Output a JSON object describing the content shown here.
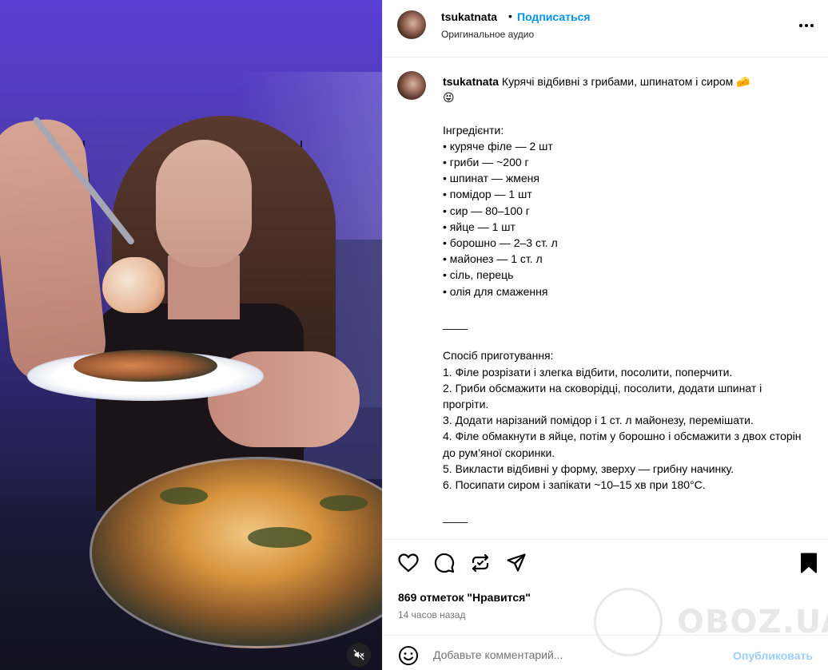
{
  "media": {
    "mute_icon": "speaker-muted-icon"
  },
  "header": {
    "username": "tsukatnata",
    "separator": "•",
    "follow_label": "Подписаться",
    "audio_label": "Оригинальное аудио",
    "more_icon": "more-horizontal-icon"
  },
  "caption": {
    "username": "tsukatnata",
    "text": " Курячі відбивні з грибами, шпинатом і сиром 🧀\n😝\n\nІнгредієнти:\n• куряче філе — 2 шт\n• гриби — ~200 г\n• шпинат — жменя\n• помідор — 1 шт\n• сир — 80–100 г\n• яйце — 1 шт\n• борошно — 2–3 ст. л\n• майонез — 1 ст. л\n• сіль, перець\n• олія для смаження\n\n____\n\nСпосіб приготування:\n1. Філе розрізати і злегка відбити, посолити, поперчити.\n2. Гриби обсмажити на сковорідці, посолити, додати шпинат і прогріти.\n3. Додати нарізаний помідор і 1 ст. л майонезу, перемішати.\n4. Філе обмакнути в яйце, потім у борошно і обсмажити з двох сторін до рум’яної скоринки.\n5. Викласти відбивні у форму, зверху — грибну начинку.\n6. Посипати сиром і запікати ~10–15 хв при 180°C.\n\n____"
  },
  "actions": {
    "icons": [
      "heart-icon",
      "comment-icon",
      "repost-icon",
      "share-icon",
      "bookmark-icon"
    ],
    "likes_text": "869 отметок \"Нравится\"",
    "time_text": "14 часов назад"
  },
  "watermark": {
    "text": "OBOZ.UA"
  },
  "comment": {
    "placeholder": "Добавьте комментарий...",
    "publish_label": "Опубликовать",
    "emoji_icon": "emoji-smile-icon"
  },
  "colors": {
    "accent": "#0095f6",
    "publish_disabled": "#9ccffb",
    "secondary_text": "#737373",
    "divider": "#efefef"
  }
}
